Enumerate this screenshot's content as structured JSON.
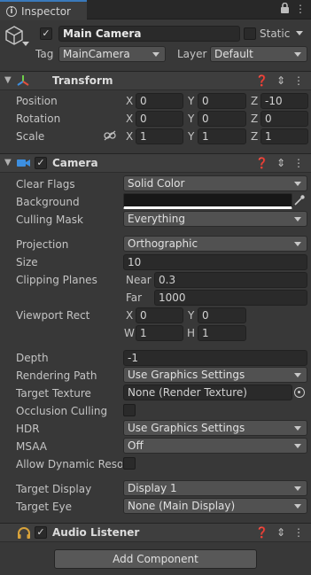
{
  "window": {
    "tab_label": "Inspector",
    "lock_icon": "lock-icon",
    "menu_icon": "kebab-menu-icon"
  },
  "gameobject": {
    "active_checked": true,
    "name": "Main Camera",
    "static_label": "Static",
    "static_checked": false,
    "tag_label": "Tag",
    "tag_value": "MainCamera",
    "layer_label": "Layer",
    "layer_value": "Default"
  },
  "transform": {
    "title": "Transform",
    "position_label": "Position",
    "rotation_label": "Rotation",
    "scale_label": "Scale",
    "position": {
      "x": "0",
      "y": "0",
      "z": "-10"
    },
    "rotation": {
      "x": "0",
      "y": "0",
      "z": "0"
    },
    "scale": {
      "x": "1",
      "y": "1",
      "z": "1"
    },
    "axes": {
      "x": "X",
      "y": "Y",
      "z": "Z"
    }
  },
  "camera": {
    "title": "Camera",
    "enabled": true,
    "clear_flags_label": "Clear Flags",
    "clear_flags_value": "Solid Color",
    "background_label": "Background",
    "background_color": "#171717",
    "culling_mask_label": "Culling Mask",
    "culling_mask_value": "Everything",
    "projection_label": "Projection",
    "projection_value": "Orthographic",
    "size_label": "Size",
    "size_value": "10",
    "clipping_planes_label": "Clipping Planes",
    "near_label": "Near",
    "near_value": "0.3",
    "far_label": "Far",
    "far_value": "1000",
    "viewport_rect_label": "Viewport Rect",
    "viewport": {
      "x_label": "X",
      "x": "0",
      "y_label": "Y",
      "y": "0",
      "w_label": "W",
      "w": "1",
      "h_label": "H",
      "h": "1"
    },
    "depth_label": "Depth",
    "depth_value": "-1",
    "rendering_path_label": "Rendering Path",
    "rendering_path_value": "Use Graphics Settings",
    "target_texture_label": "Target Texture",
    "target_texture_value": "None (Render Texture)",
    "occlusion_culling_label": "Occlusion Culling",
    "occlusion_culling_checked": false,
    "hdr_label": "HDR",
    "hdr_value": "Use Graphics Settings",
    "msaa_label": "MSAA",
    "msaa_value": "Off",
    "allow_dynamic_label": "Allow Dynamic Resol",
    "allow_dynamic_checked": false,
    "target_display_label": "Target Display",
    "target_display_value": "Display 1",
    "target_eye_label": "Target Eye",
    "target_eye_value": "None (Main Display)"
  },
  "audio_listener": {
    "title": "Audio Listener",
    "enabled": true
  },
  "add_component_label": "Add Component",
  "colors": {
    "panel_bg": "#383838",
    "field_bg": "#2a2a2a",
    "dropdown_bg": "#515151",
    "accent_tab": "#3a79bb"
  }
}
